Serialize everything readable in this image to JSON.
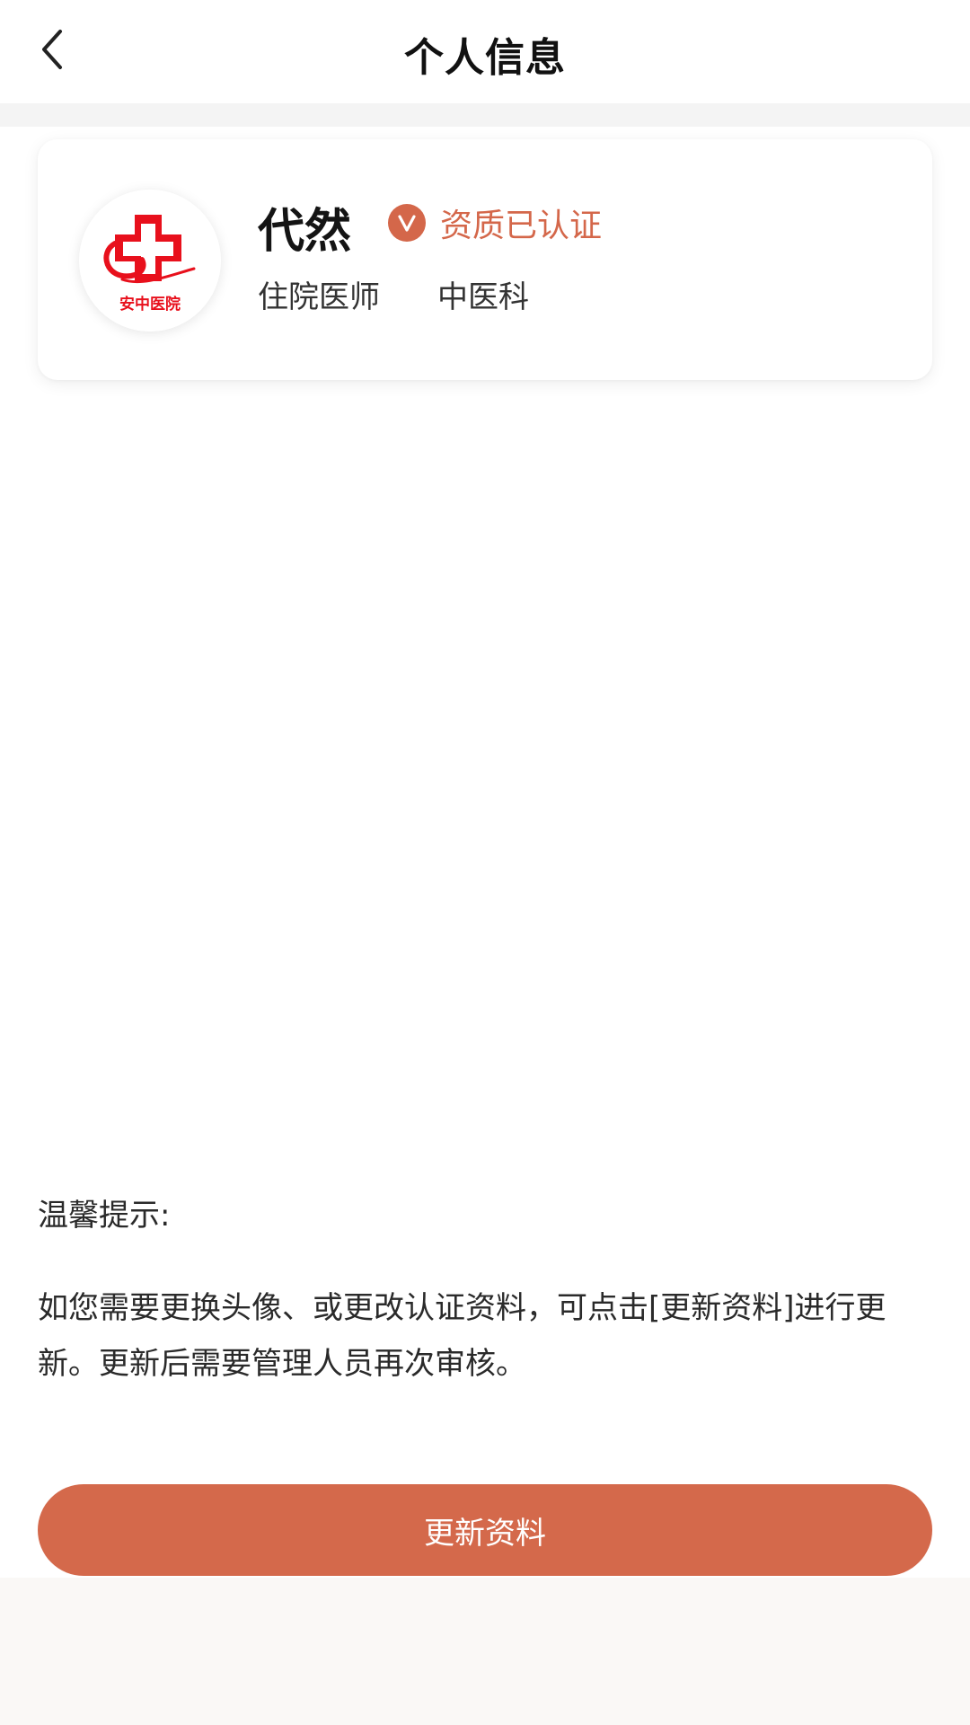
{
  "header": {
    "title": "个人信息",
    "back_icon": "chevron-left-icon"
  },
  "profile": {
    "name": "代然",
    "verified_label": "资质已认证",
    "verified_icon": "verified-v-icon",
    "position": "住院医师",
    "department": "中医科",
    "avatar_logo_text": "安中医院"
  },
  "tips": {
    "heading": "温馨提示:",
    "body": "如您需要更换头像、或更改认证资料，可点击[更新资料]进行更新。更新后需要管理人员再次审核。"
  },
  "actions": {
    "update_label": "更新资料"
  },
  "colors": {
    "accent": "#d4694b",
    "logo_red": "#e8101c"
  }
}
